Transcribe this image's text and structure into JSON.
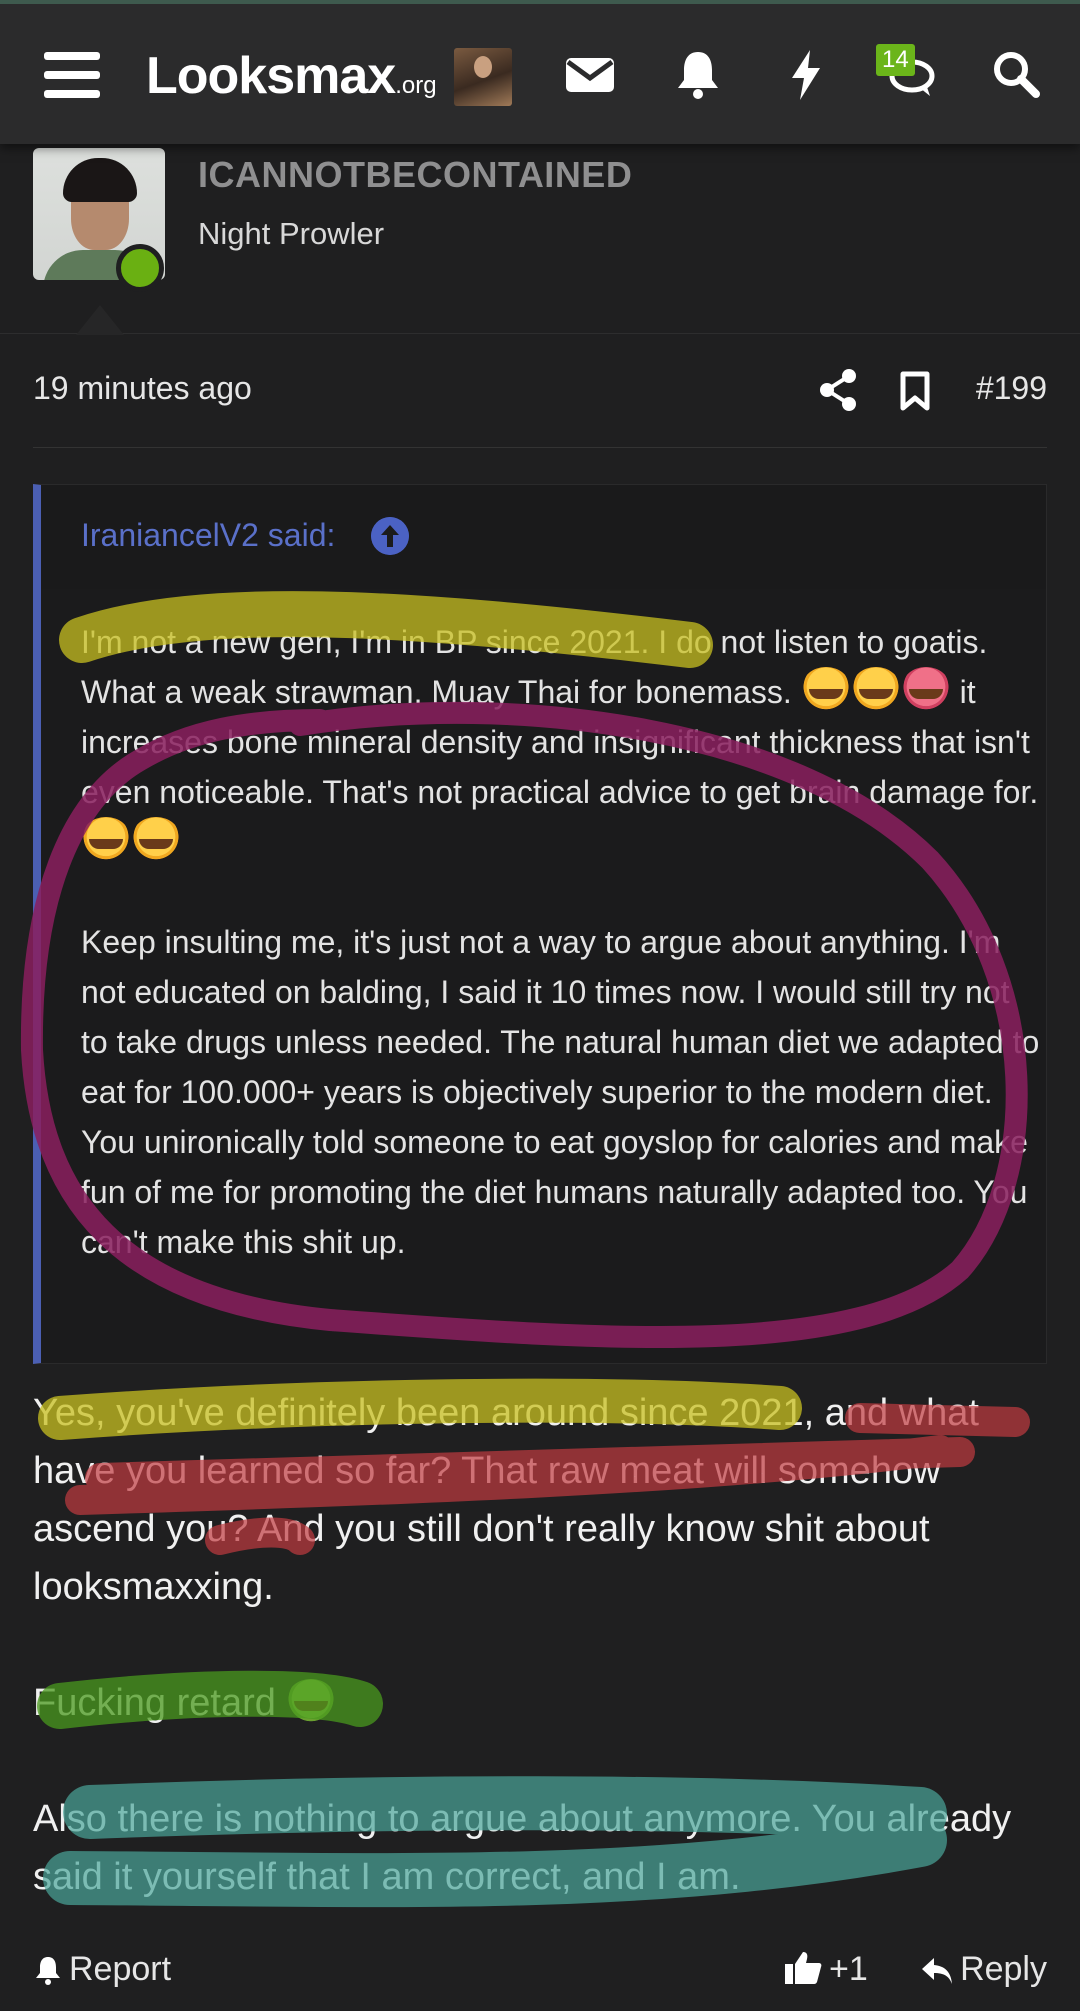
{
  "nav": {
    "logo_main": "Looksmax",
    "logo_suffix": ".org",
    "conversations_badge": "14",
    "icons": [
      "menu-icon",
      "envelope-icon",
      "bell-icon",
      "lightning-icon",
      "conversations-icon",
      "search-icon"
    ]
  },
  "user": {
    "username": "ICANNOTBECONTAINED",
    "title": "Night Prowler",
    "online_color": "#6ab012"
  },
  "post": {
    "time": "19 minutes ago",
    "number": "#199"
  },
  "quote": {
    "author": "IraniancelV2 said:",
    "p1_a": "I'm not a new gen, I'm in BP since 2021. I do not listen to goatis. What a weak strawman. Muay Thai for bonemass.",
    "p1_b": "it increases bone mineral density and insignificant thickness that isn't even noticeable. That's not practical advice to get brain damage for.",
    "p2": "Keep insulting me, it's just not a way to argue about anything. I'm not educated on balding, I said it 10 times now. I would still try not to take drugs unless needed. The natural human diet we adapted to eat for 100.000+ years is objectively superior to the modern diet. You unironically told someone to eat goyslop for calories and make fun of me for promoting the diet humans naturally adapted too. You can't make this shit up."
  },
  "reply": {
    "p1": "Yes, you've definitely been around since 2021, and what have you learned so far? That raw meat will somehow ascend you? And you still don't really know shit about looksmaxxing.",
    "p2": "Fucking retard",
    "p3": "Also there is nothing to argue about anymore. You already said it yourself that I am correct, and I am."
  },
  "actions": {
    "report": "Report",
    "likes": "+1",
    "reply": "Reply"
  },
  "colors": {
    "accent_quote": "#4b5fb3",
    "highlight_yellow": "#c8c020",
    "highlight_magenta": "#8a1f5e",
    "highlight_red": "#c03a40",
    "highlight_green": "#4a9a1e",
    "highlight_teal": "#4aa59a"
  }
}
